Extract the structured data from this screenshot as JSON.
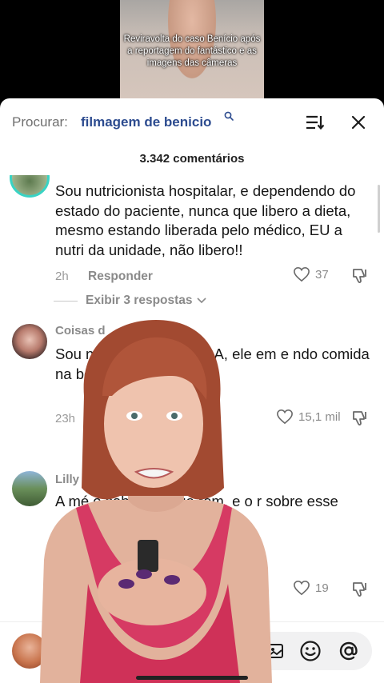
{
  "video": {
    "caption": "Reviravolta do caso Benício após a reportagem do fantástico e as imagens das câmeras"
  },
  "search": {
    "prefix": "Procurar:",
    "query": "filmagem de benicio"
  },
  "comments_header": {
    "count_label": "3.342 comentários"
  },
  "comments": [
    {
      "author": "",
      "text": "Sou nutricionista hospitalar, e dependendo do estado do paciente, nunca que libero a dieta, mesmo estando liberada pelo médico, EU a nutri da unidade, não libero!!",
      "time": "2h",
      "reply_label": "Responder",
      "likes": "37",
      "view_replies": "Exibir 3 respostas"
    },
    {
      "author": "Coisas d",
      "text": "Sou n e fiquei CHOCADA, ele em e ndo comida na boca dele absoluto!!!",
      "time": "23h",
      "reply_label": "",
      "likes": "15,1 mil"
    },
    {
      "author": "Lilly h",
      "text": "A mé o sabiam o que rem, e o r sobre esse",
      "time": "",
      "reply_label": "",
      "likes": "19"
    }
  ],
  "bottom": {
    "input_placeholder": ""
  },
  "colors": {
    "query_blue": "#2c4b8f",
    "avatar_ring": "#39d3c4",
    "text": "#161616",
    "muted": "#8a8a8a"
  },
  "icons": [
    "search-icon",
    "sort-icon",
    "close-icon",
    "heart-icon",
    "dislike-icon",
    "chevron-down-icon",
    "emoji-icon",
    "at-icon",
    "image-icon"
  ]
}
